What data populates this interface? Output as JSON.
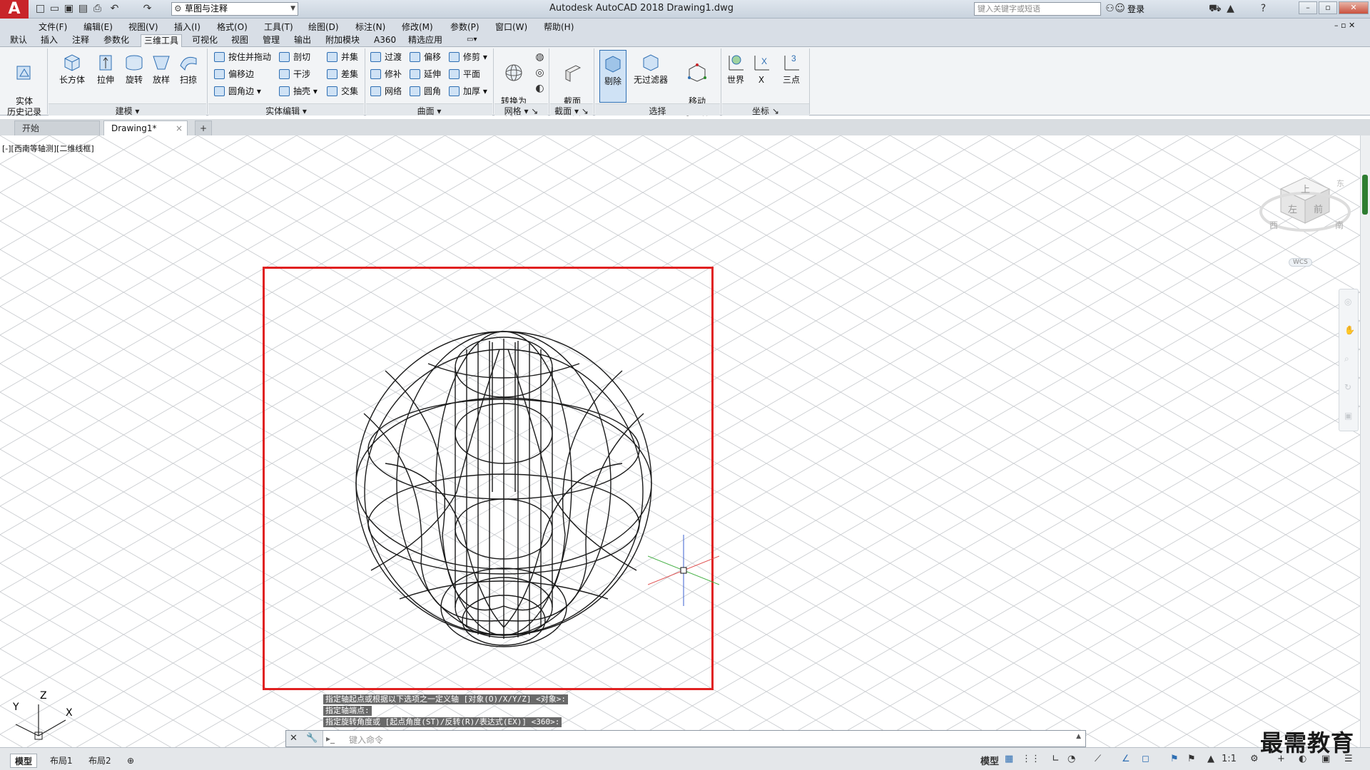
{
  "titlebar": {
    "logo": "A",
    "workspace": "草图与注释",
    "app_title": "Autodesk AutoCAD 2018    Drawing1.dwg",
    "search_placeholder": "键入关键字或短语",
    "login": "登录"
  },
  "menubar": [
    "文件(F)",
    "编辑(E)",
    "视图(V)",
    "插入(I)",
    "格式(O)",
    "工具(T)",
    "绘图(D)",
    "标注(N)",
    "修改(M)",
    "参数(P)",
    "窗口(W)",
    "帮助(H)"
  ],
  "ribbon_tabs": [
    "默认",
    "插入",
    "注释",
    "参数化",
    "三维工具",
    "可视化",
    "视图",
    "管理",
    "输出",
    "附加模块",
    "A360",
    "精选应用"
  ],
  "ribbon_active": "三维工具",
  "ribbon": {
    "history": "实体\n历史记录",
    "modeling": [
      "长方体",
      "拉伸",
      "旋转",
      "放样",
      "扫掠"
    ],
    "modeling_title": "建模",
    "solid_edit_col1": [
      "按住并拖动",
      "偏移边",
      "圆角边"
    ],
    "solid_edit_col2": [
      "剖切",
      "干涉",
      "抽壳"
    ],
    "solid_edit_col3": [
      "并集",
      "差集",
      "交集"
    ],
    "solid_edit_title": "实体编辑",
    "surface_col1": [
      "过渡",
      "修补",
      "网络"
    ],
    "surface_col2": [
      "偏移",
      "延伸",
      "圆角"
    ],
    "surface_col3": [
      "修剪",
      "平面",
      "加厚"
    ],
    "surface_title": "曲面",
    "mesh_btn": "转换为\n网格",
    "mesh_title": "网格",
    "section_btn": "截面\n平面",
    "section_title": "截面",
    "select_btns": [
      "剔除",
      "无过滤器",
      "移动\n小控件"
    ],
    "select_title": "选择",
    "coord_btns": [
      "世界",
      "X",
      "三点"
    ],
    "coord_title": "坐标"
  },
  "file_tabs": [
    "开始",
    "Drawing1*"
  ],
  "viewport": {
    "label": "[-][西南等轴测][二维线框]",
    "viewcube_top": "上",
    "viewcube_front": "前",
    "viewcube_left": "左",
    "viewcube_west": "西",
    "viewcube_south": "南",
    "viewcube_east": "东",
    "wcs": "WCS",
    "ucs_x": "X",
    "ucs_y": "Y",
    "ucs_z": "Z"
  },
  "command": {
    "history": [
      "指定轴起点或根据以下选项之一定义轴 [对象(O)/X/Y/Z] <对象>:",
      "指定轴端点:",
      "指定旋转角度或 [起点角度(ST)/反转(R)/表达式(EX)] <360>:"
    ],
    "placeholder": "键入命令"
  },
  "layout_tabs": [
    "模型",
    "布局1",
    "布局2"
  ],
  "status": {
    "model": "模型",
    "scale": "1:1"
  },
  "watermark": "最需教育",
  "colors": {
    "highlight_box": "#e02020",
    "accent": "#2f6fb3"
  }
}
